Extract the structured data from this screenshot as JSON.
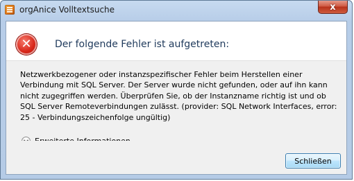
{
  "window": {
    "title": "orgAnice Volltextsuche",
    "close_glyph": "x"
  },
  "dialog": {
    "main_instruction": "Der folgende Fehler ist aufgetreten:",
    "message": "Netzwerkbezogener oder instanzspezifischer Fehler beim Herstellen einer Verbindung mit SQL Server. Der Server wurde nicht gefunden, oder auf ihn kann nicht zugegriffen werden. Überprüfen Sie, ob der Instanzname richtig ist und ob SQL Server Remoteverbindungen zulässt. (provider: SQL Network Interfaces, error: 25 - Verbindungszeichenfolge ungültig)",
    "expander_label": "Erweiterte Informationen",
    "close_button_label": "Schließen"
  },
  "icons": {
    "app": "organice-app-icon",
    "error": "error-icon",
    "expander": "chevron-down-icon"
  },
  "colors": {
    "error_red": "#d9281b",
    "instruction_blue": "#1e395b",
    "titlebar": "#b9cfe9"
  }
}
